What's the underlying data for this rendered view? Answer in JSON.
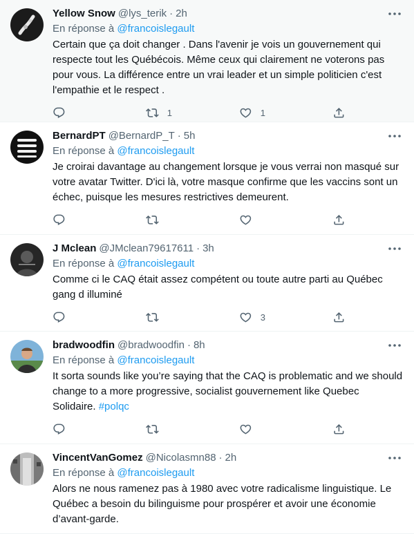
{
  "tweets": [
    {
      "name": "Yellow Snow",
      "handle": "@lys_terik",
      "time": "2h",
      "reply_prefix": "En réponse à",
      "reply_to": "@francoislegault",
      "text": "Certain que ça doit changer . Dans l'avenir je vois un gouvernement qui respecte tout les Québécois. Même ceux qui clairement ne voterons pas pour vous. La différence entre un vrai leader et un simple politicien c'est l'empathie et le respect .",
      "hashtag": "",
      "retweets": "1",
      "likes": "1"
    },
    {
      "name": "BernardPT",
      "handle": "@BernardP_T",
      "time": "5h",
      "reply_prefix": "En réponse à",
      "reply_to": "@francoislegault",
      "text": "Je croirai davantage au changement lorsque je vous verrai non masqué sur votre avatar Twitter. D'ici là, votre masque confirme que les vaccins sont un échec, puisque les mesures restrictives demeurent.",
      "hashtag": "",
      "retweets": "",
      "likes": ""
    },
    {
      "name": "J Mclean",
      "handle": "@JMclean79617611",
      "time": "3h",
      "reply_prefix": "En réponse à",
      "reply_to": "@francoislegault",
      "text": "Comme ci le CAQ était assez compétent ou toute autre parti au Québec gang d illuminé",
      "hashtag": "",
      "retweets": "",
      "likes": "3"
    },
    {
      "name": "bradwoodfin",
      "handle": "@bradwoodfin",
      "time": "8h",
      "reply_prefix": "En réponse à",
      "reply_to": "@francoislegault",
      "text": "It sorta sounds like you’re saying that the CAQ is problematic and we should change to a more progressive, socialist gouvernement like Quebec Solidaire.",
      "hashtag": "#polqc",
      "retweets": "",
      "likes": ""
    },
    {
      "name": "VincentVanGomez",
      "handle": "@Nicolasmn88",
      "time": "2h",
      "reply_prefix": "En réponse à",
      "reply_to": "@francoislegault",
      "text": "Alors ne nous ramenez pas à 1980 avec votre radicalisme linguistique. Le Québec a besoin du bilinguisme pour prospérer et avoir une économie d’avant-garde.",
      "hashtag": "",
      "retweets": "",
      "likes": ""
    }
  ],
  "dot": "·",
  "colors": {
    "link": "#1d9bf0",
    "muted": "#536471",
    "text": "#0f1419",
    "highlight_bg": "#f7f9f9"
  },
  "icons": [
    "more-icon",
    "reply-icon",
    "retweet-icon",
    "like-icon",
    "share-icon"
  ]
}
